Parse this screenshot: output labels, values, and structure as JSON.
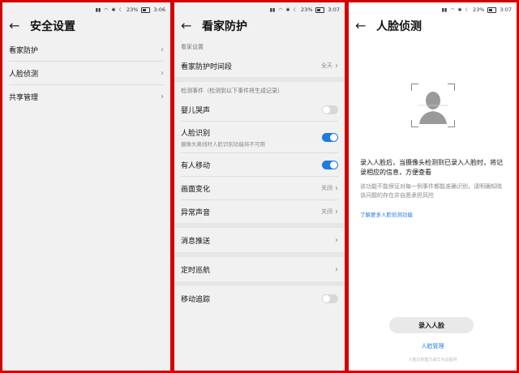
{
  "status": {
    "left_panel": {
      "battery": "23%",
      "time": "3:06"
    },
    "middle_panel": {
      "battery": "23%",
      "time": "3:07"
    },
    "right_panel": {
      "battery": "23%",
      "time": "3:07"
    }
  },
  "security_settings": {
    "title": "安全设置",
    "items": [
      {
        "label": "看家防护"
      },
      {
        "label": "人脸侦测"
      },
      {
        "label": "共享管理"
      }
    ]
  },
  "home_guard": {
    "title": "看家防护",
    "section_settings": "看家设置",
    "period": {
      "label": "看家防护时间段",
      "value": "全天"
    },
    "section_events": "检测事件（检测到以下事件将生成记录）",
    "events": [
      {
        "label": "婴儿哭声",
        "on": false
      },
      {
        "label": "人脸识别",
        "sub": "摄像头离线时人脸识别功能将不可用",
        "on": true
      },
      {
        "label": "有人移动",
        "on": true
      }
    ],
    "picture_change": {
      "label": "画面变化",
      "value": "关闭"
    },
    "abnormal_sound": {
      "label": "异常声音",
      "value": "关闭"
    },
    "message_push": "消息推送",
    "timed_patrol": "定时巡航",
    "motion_tracking": {
      "label": "移动追踪",
      "on": false
    }
  },
  "face_detection": {
    "title": "人脸侦测",
    "intro_main": "录入人脸后，当摄像头检测到已录入人脸时，将记录相应的信息，方便查看",
    "intro_note": "该功能不能保证对每一例事件都能准确识别，请明确知晓该问题的存在并自愿承担风险",
    "learn_more": "了解更多人脸侦测功能",
    "enroll_button": "录入人脸",
    "manage_link": "人脸管理",
    "footnote": "人脸识别能力由华为云提供"
  },
  "colors": {
    "accent": "#1e7be0",
    "frame": "#d40000"
  },
  "icons": {
    "back": "arrow-left-icon",
    "chevron": "chevron-right-icon",
    "face": "face-silhouette-icon"
  }
}
